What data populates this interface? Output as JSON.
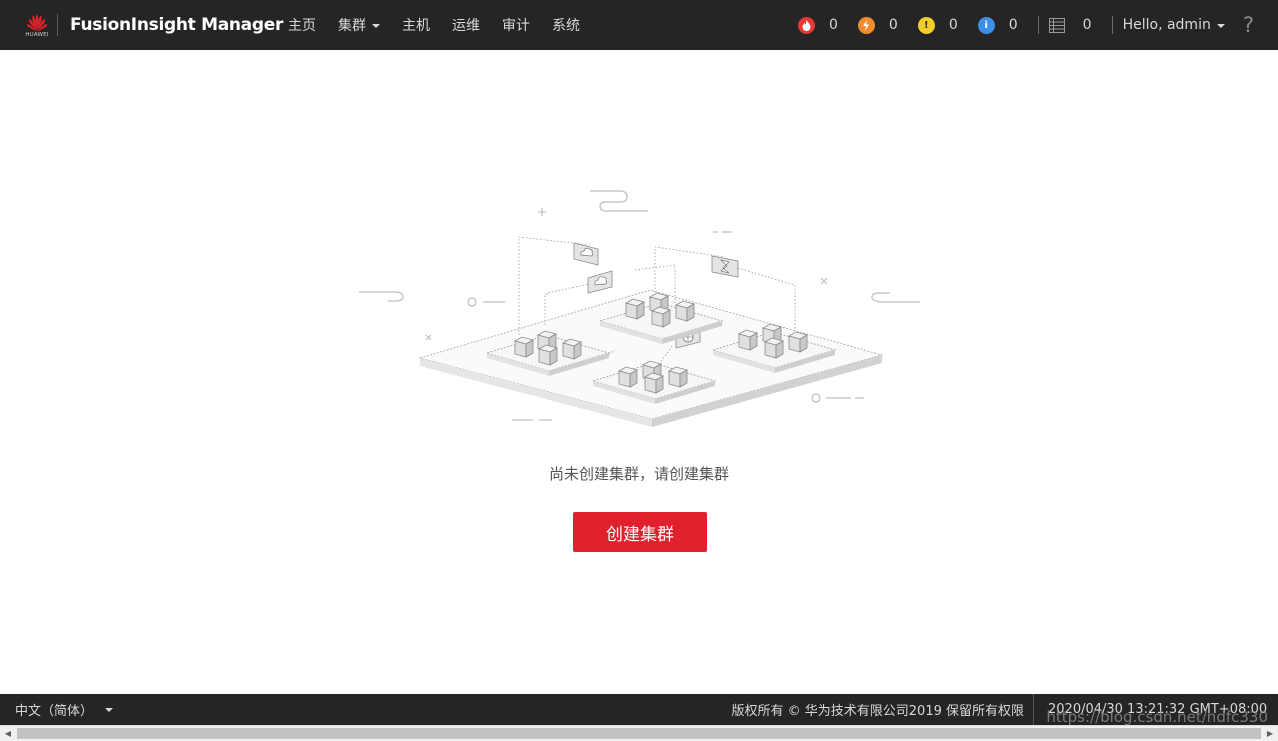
{
  "header": {
    "brand_logo_text": "HUAWEI",
    "app_title": "FusionInsight Manager",
    "nav": [
      {
        "label": "主页"
      },
      {
        "label": "集群"
      },
      {
        "label": "主机"
      },
      {
        "label": "运维"
      },
      {
        "label": "审计"
      },
      {
        "label": "系统"
      }
    ],
    "alarms": [
      {
        "icon": "critical-alarm-icon",
        "count": "0",
        "color": "#e53935"
      },
      {
        "icon": "major-alarm-icon",
        "count": "0",
        "color": "#f08c2e"
      },
      {
        "icon": "minor-alarm-icon",
        "count": "0",
        "color": "#f2cd2c"
      },
      {
        "icon": "warning-alarm-icon",
        "count": "0",
        "color": "#3f8fe8"
      }
    ],
    "tasks": {
      "icon": "task-list-icon",
      "count": "0"
    },
    "user_greeting": "Hello, admin",
    "help_icon": "?"
  },
  "main": {
    "empty_message": "尚未创建集群，请创建集群",
    "create_button_label": "创建集群",
    "accent_color": "#e0202c"
  },
  "footer": {
    "language": "中文（简体）",
    "copyright": "版权所有 © 华为技术有限公司2019 保留所有权限",
    "datetime": "2020/04/30 13:21:32 GMT+08:00"
  },
  "watermark": "https://blog.csdn.net/ndfc330"
}
